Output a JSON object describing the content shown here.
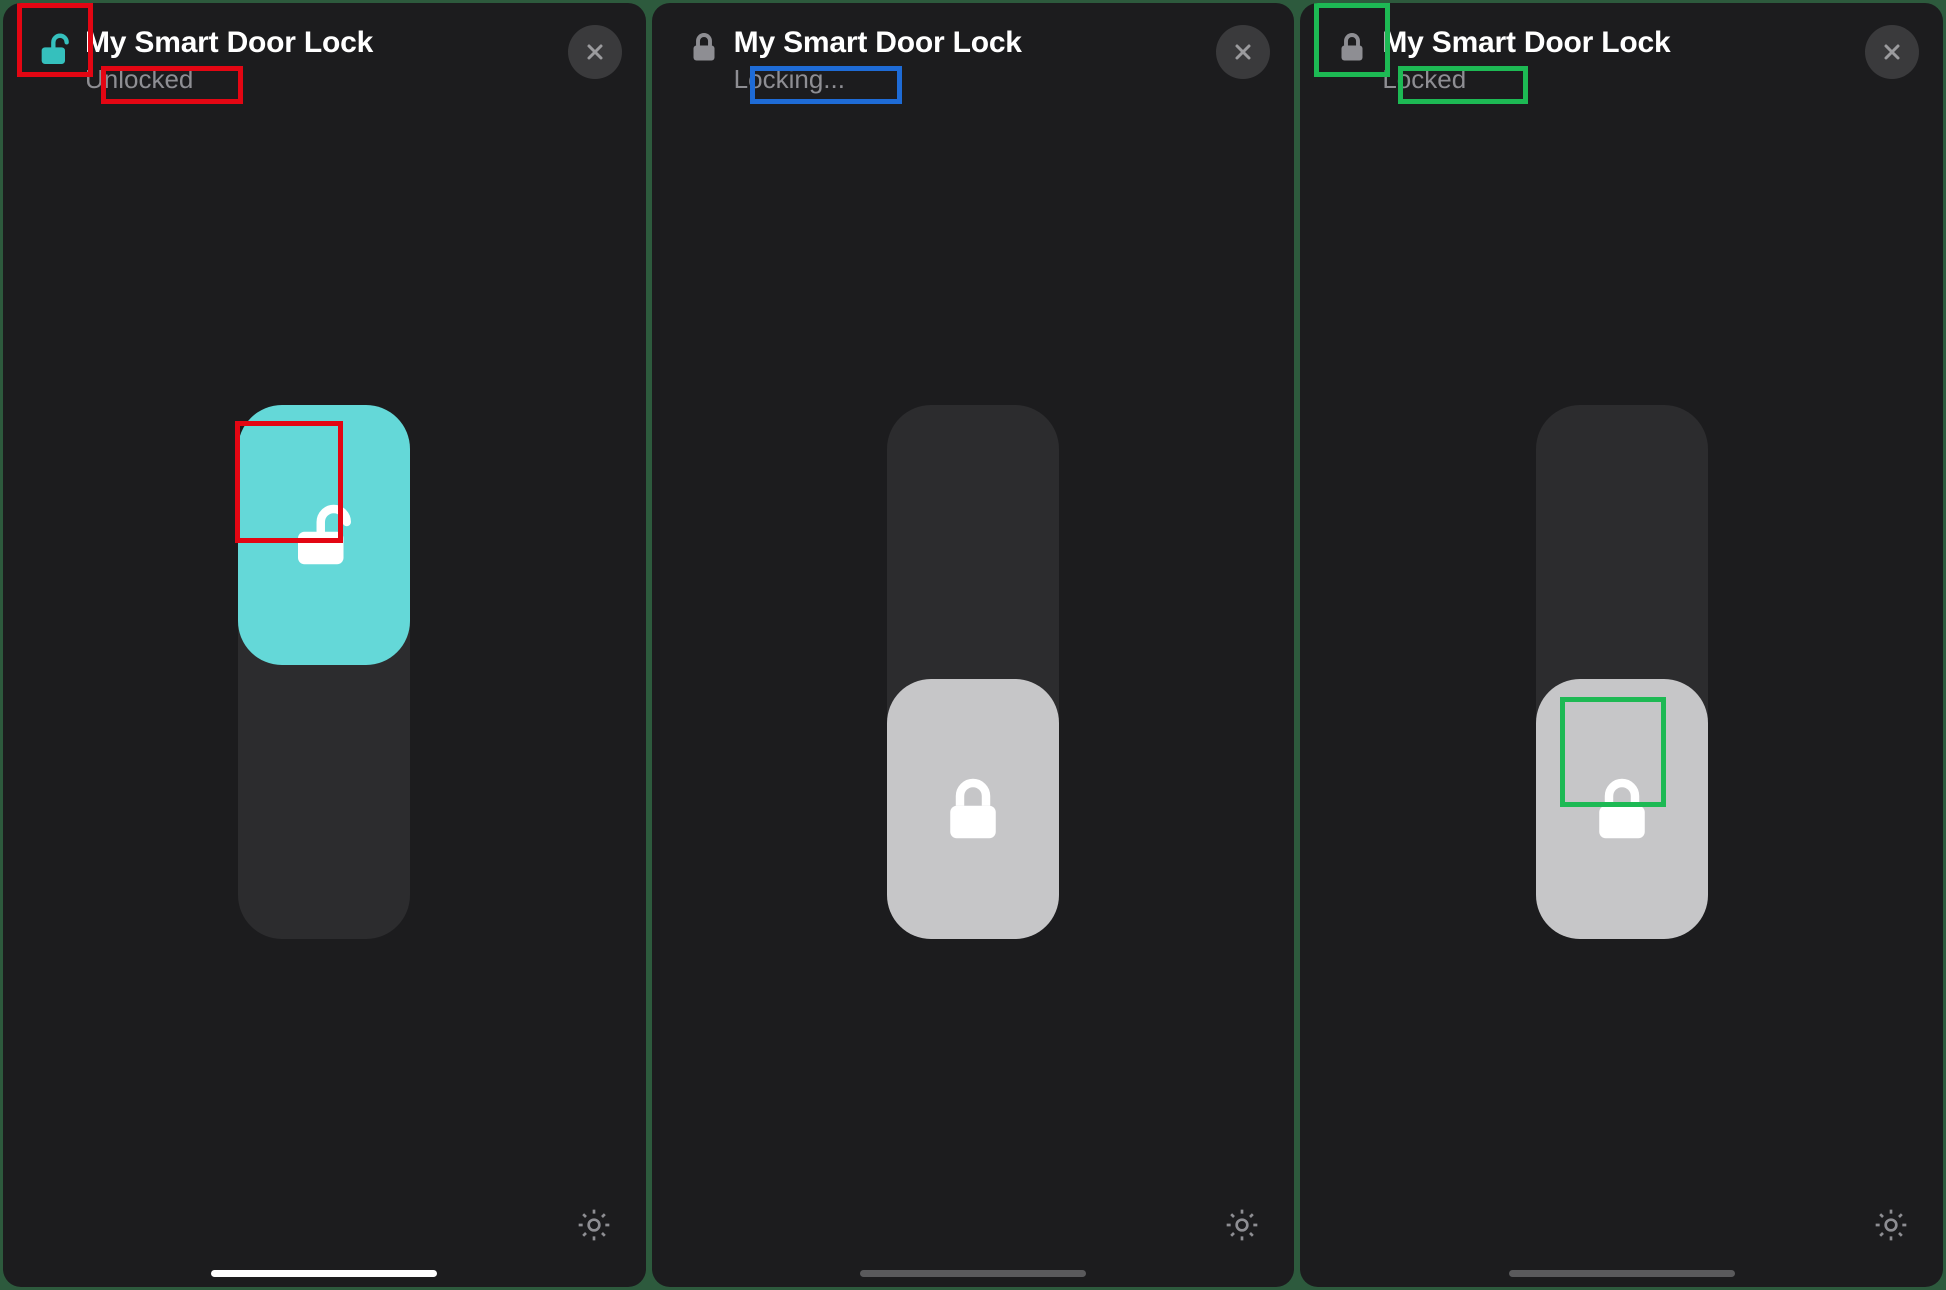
{
  "panels": [
    {
      "title": "My Smart Door Lock",
      "status": "Unlocked",
      "header_icon": "unlock-icon",
      "header_icon_color": "#35c0bd",
      "knob_position": "top",
      "knob_style": "unlocked",
      "knob_icon": "unlock-icon",
      "home_indicator_bright": true,
      "annotations": [
        {
          "class": "annot-red p1-icon-annot"
        },
        {
          "class": "annot-red p1-status-annot"
        },
        {
          "class": "annot-red p1-knob-annot"
        }
      ]
    },
    {
      "title": "My Smart Door Lock",
      "status": "Locking...",
      "header_icon": "lock-icon",
      "header_icon_color": "#8e8e93",
      "knob_position": "bottom",
      "knob_style": "locked",
      "knob_icon": "lock-icon",
      "home_indicator_bright": false,
      "annotations": [
        {
          "class": "annot-blue p2-status-annot"
        }
      ]
    },
    {
      "title": "My Smart Door Lock",
      "status": "Locked",
      "header_icon": "lock-icon",
      "header_icon_color": "#8e8e93",
      "knob_position": "bottom",
      "knob_style": "locked",
      "knob_icon": "lock-icon",
      "home_indicator_bright": false,
      "annotations": [
        {
          "class": "annot-green p3-icon-annot"
        },
        {
          "class": "annot-green p3-status-annot"
        },
        {
          "class": "annot-green p3-knob-annot"
        }
      ]
    }
  ],
  "colors": {
    "accent_teal": "#64d8d8",
    "grey_knob": "#c6c6c8",
    "annot_red": "#e30613",
    "annot_blue": "#1e6bd6",
    "annot_green": "#1db954"
  }
}
